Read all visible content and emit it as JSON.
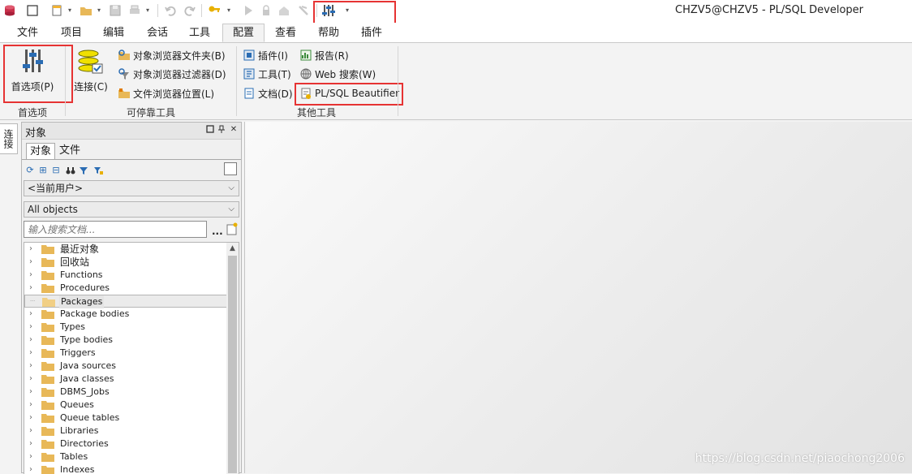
{
  "window": {
    "title": "CHZV5@CHZV5 - PL/SQL Developer"
  },
  "ribbon_tabs": [
    {
      "label": "文件"
    },
    {
      "label": "项目"
    },
    {
      "label": "编辑"
    },
    {
      "label": "会话"
    },
    {
      "label": "工具"
    },
    {
      "label": "配置"
    },
    {
      "label": "查看"
    },
    {
      "label": "帮助"
    },
    {
      "label": "插件"
    }
  ],
  "ribbon": {
    "preferences": {
      "button": "首选项(P)",
      "group_label": "首选项"
    },
    "dockable": {
      "connection_button": "连接(C)",
      "object_browser_folders": "对象浏览器文件夹(B)",
      "object_browser_filters": "对象浏览器过滤器(D)",
      "file_browser_locations": "文件浏览器位置(L)",
      "group_label": "可停靠工具"
    },
    "other": {
      "plugins": "插件(I)",
      "tools": "工具(T)",
      "documents": "文档(D)",
      "reports": "报告(R)",
      "web_search": "Web 搜索(W)",
      "beautifier": "PL/SQL Beautifier",
      "group_label": "其他工具"
    }
  },
  "side_tab": "连接",
  "object_panel": {
    "title": "对象",
    "tabs": [
      "对象",
      "文件"
    ],
    "user_select": "<当前用户>",
    "type_select": "All objects",
    "search_placeholder": "输入搜索文档...",
    "tree": [
      {
        "label": "最近对象"
      },
      {
        "label": "回收站"
      },
      {
        "label": "Functions"
      },
      {
        "label": "Procedures"
      },
      {
        "label": "Packages"
      },
      {
        "label": "Package bodies"
      },
      {
        "label": "Types"
      },
      {
        "label": "Type bodies"
      },
      {
        "label": "Triggers"
      },
      {
        "label": "Java sources"
      },
      {
        "label": "Java classes"
      },
      {
        "label": "DBMS_Jobs"
      },
      {
        "label": "Queues"
      },
      {
        "label": "Queue tables"
      },
      {
        "label": "Libraries"
      },
      {
        "label": "Directories"
      },
      {
        "label": "Tables"
      },
      {
        "label": "Indexes"
      }
    ]
  },
  "watermark": "https://blog.csdn.net/piaochong2006",
  "colors": {
    "highlight_box": "#e63333",
    "folder": "#e8b858",
    "accent_icon": "#2a6cb3"
  }
}
